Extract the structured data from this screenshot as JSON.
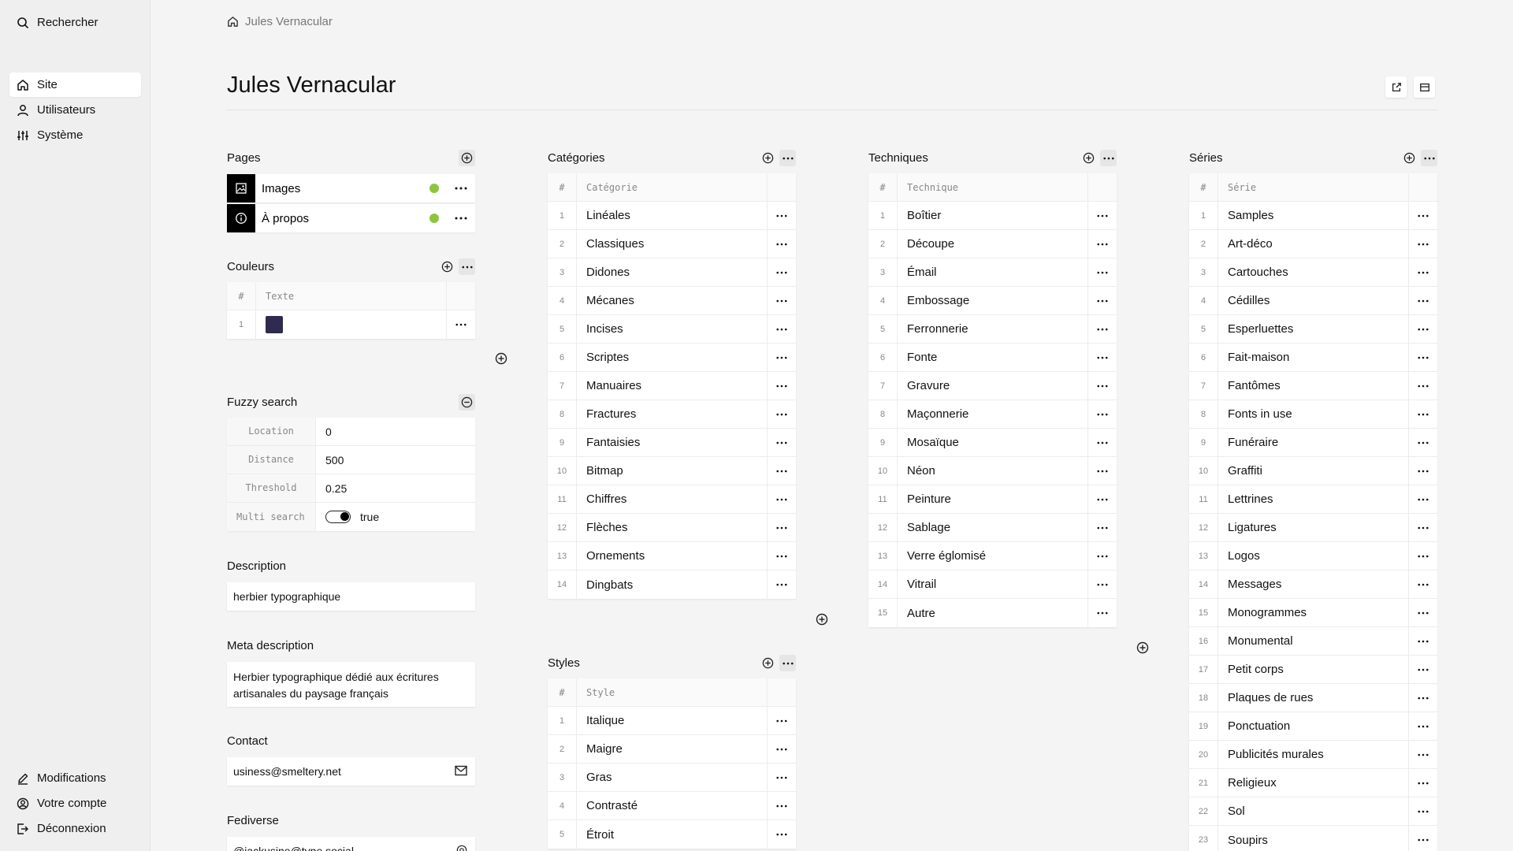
{
  "sidebar": {
    "search": "Rechercher",
    "nav": [
      "Site",
      "Utilisateurs",
      "Système"
    ],
    "bottom": [
      "Modifications",
      "Votre compte",
      "Déconnexion"
    ]
  },
  "breadcrumb": "Jules Vernacular",
  "title": "Jules Vernacular",
  "sections": {
    "pages": "Pages",
    "couleurs": "Couleurs",
    "fuzzy": "Fuzzy search",
    "description": "Description",
    "meta": "Meta description",
    "contact": "Contact",
    "fediverse": "Fediverse",
    "categories": "Catégories",
    "styles": "Styles",
    "techniques": "Techniques",
    "series": "Séries"
  },
  "pages": [
    {
      "label": "Images",
      "status": "#8cc63f"
    },
    {
      "label": "À propos",
      "status": "#8cc63f"
    }
  ],
  "couleurs": {
    "headers": [
      "#",
      "Texte"
    ],
    "rows": [
      {
        "num": "1",
        "color": "#2f2a4f"
      }
    ]
  },
  "fuzzy": {
    "rows": [
      {
        "key": "Location",
        "value": "0"
      },
      {
        "key": "Distance",
        "value": "500"
      },
      {
        "key": "Threshold",
        "value": "0.25"
      }
    ],
    "multi_key": "Multi search",
    "multi_value": "true"
  },
  "fields": {
    "description": "herbier typographique",
    "meta": "Herbier typographique dédié aux écritures artisanales du paysage français",
    "contact": "usiness@smeltery.net",
    "fediverse": "@jackusine@type.social"
  },
  "categories": {
    "headers": [
      "#",
      "Catégorie"
    ],
    "rows": [
      "Linéales",
      "Classiques",
      "Didones",
      "Mécanes",
      "Incises",
      "Scriptes",
      "Manuaires",
      "Fractures",
      "Fantaisies",
      "Bitmap",
      "Chiffres",
      "Flèches",
      "Ornements",
      "Dingbats"
    ]
  },
  "styles": {
    "headers": [
      "#",
      "Style"
    ],
    "rows": [
      "Italique",
      "Maigre",
      "Gras",
      "Contrasté",
      "Étroit"
    ]
  },
  "techniques": {
    "headers": [
      "#",
      "Technique"
    ],
    "rows": [
      "Boîtier",
      "Découpe",
      "Émail",
      "Embossage",
      "Ferronnerie",
      "Fonte",
      "Gravure",
      "Maçonnerie",
      "Mosaïque",
      "Néon",
      "Peinture",
      "Sablage",
      "Verre églomisé",
      "Vitrail",
      "Autre"
    ]
  },
  "series": {
    "headers": [
      "#",
      "Série"
    ],
    "rows": [
      "Samples",
      "Art-déco",
      "Cartouches",
      "Cédilles",
      "Esperluettes",
      "Fait-maison",
      "Fantômes",
      "Fonts in use",
      "Funéraire",
      "Graffiti",
      "Lettrines",
      "Ligatures",
      "Logos",
      "Messages",
      "Monogrammes",
      "Monumental",
      "Petit corps",
      "Plaques de rues",
      "Ponctuation",
      "Publicités murales",
      "Religieux",
      "Sol",
      "Soupirs"
    ]
  }
}
